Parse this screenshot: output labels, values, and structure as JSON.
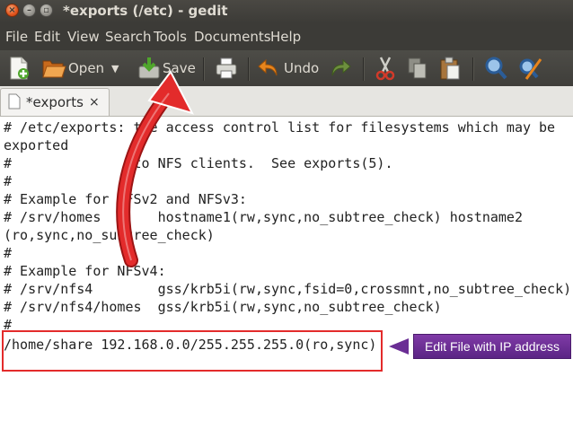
{
  "window": {
    "title": "*exports (/etc) - gedit"
  },
  "menubar": {
    "items": [
      "File",
      "Edit",
      "View",
      "Search",
      "Tools",
      "Documents",
      "Help"
    ]
  },
  "toolbar": {
    "open_label": "Open",
    "save_label": "Save",
    "undo_label": "Undo",
    "icons": [
      "new-document-icon",
      "open-folder-icon",
      "dropdown-arrow-icon",
      "save-icon",
      "print-icon",
      "undo-icon",
      "redo-icon",
      "cut-icon",
      "copy-icon",
      "paste-icon",
      "find-icon",
      "find-replace-icon"
    ]
  },
  "tab": {
    "label": "*exports",
    "close": "×"
  },
  "editor": {
    "lines": [
      "# /etc/exports: the access control list for filesystems which may be",
      "exported",
      "#               to NFS clients.  See exports(5).",
      "#",
      "# Example for NFSv2 and NFSv3:",
      "# /srv/homes       hostname1(rw,sync,no_subtree_check) hostname2",
      "(ro,sync,no_subtree_check)",
      "#",
      "# Example for NFSv4:",
      "# /srv/nfs4        gss/krb5i(rw,sync,fsid=0,crossmnt,no_subtree_check)",
      "# /srv/nfs4/homes  gss/krb5i(rw,sync,no_subtree_check)",
      "#",
      "/home/share 192.168.0.0/255.255.255.0(ro,sync)"
    ]
  },
  "annotation": {
    "callout_text": "Edit File with IP address",
    "arrow_color": "#e32b2b",
    "callout_color": "#6a2d94"
  }
}
